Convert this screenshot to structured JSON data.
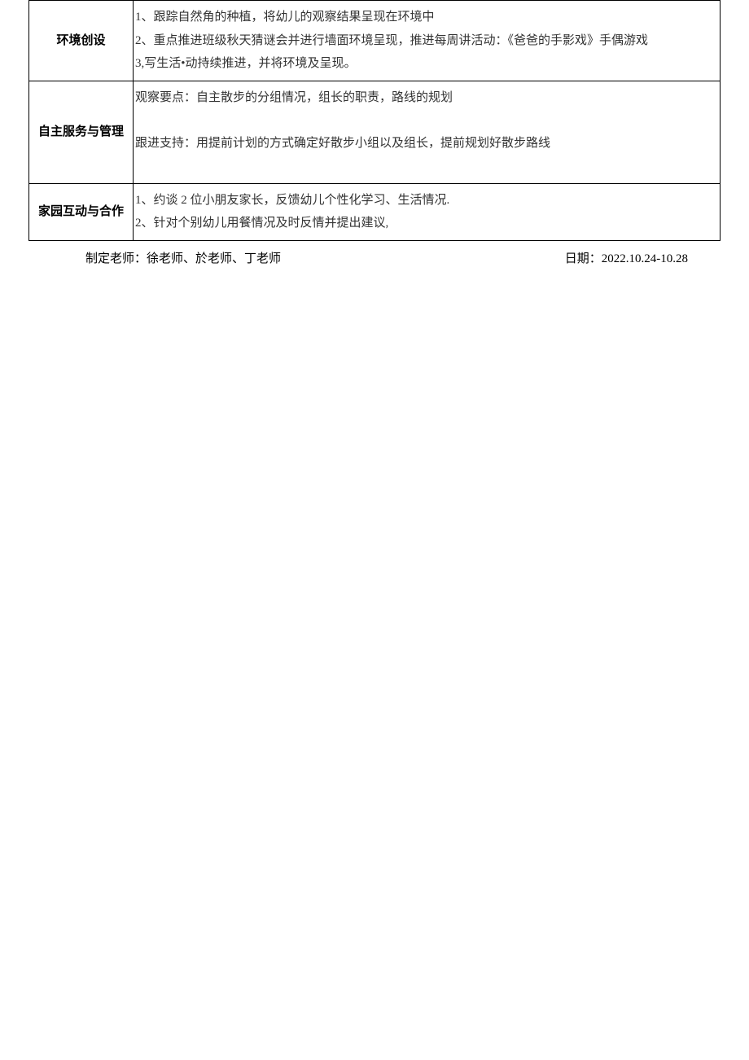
{
  "rows": [
    {
      "header": "环境创设",
      "lines": [
        "1、跟踪自然角的种植，将幼儿的观察结果呈现在环境中",
        "2、重点推进班级秋天猜谜会并进行墙面环境呈现，推进每周讲活动：《爸爸的手影戏》手偶游戏",
        "3,写生活•动持续推进，并将环境及呈现。"
      ]
    },
    {
      "header": "自主服务与管理",
      "lines": [
        "观察要点：自主散步的分组情况，组长的职责，路线的规划",
        "",
        "",
        "跟进支持：用提前计划的方式确定好散步小组以及组长，提前规划好散步路线",
        ""
      ]
    },
    {
      "header": "家园互动与合作",
      "lines": [
        "1、约谈 2 位小朋友家长，反馈幼儿个性化学习、生活情况.",
        "2、针对个别幼儿用餐情况及时反情并提出建议,"
      ]
    }
  ],
  "footer": {
    "teachers_label": "制定老师：",
    "teachers_value": "徐老师、於老师、丁老师",
    "date_label": "日期：",
    "date_value": "2022.10.24-10.28"
  }
}
